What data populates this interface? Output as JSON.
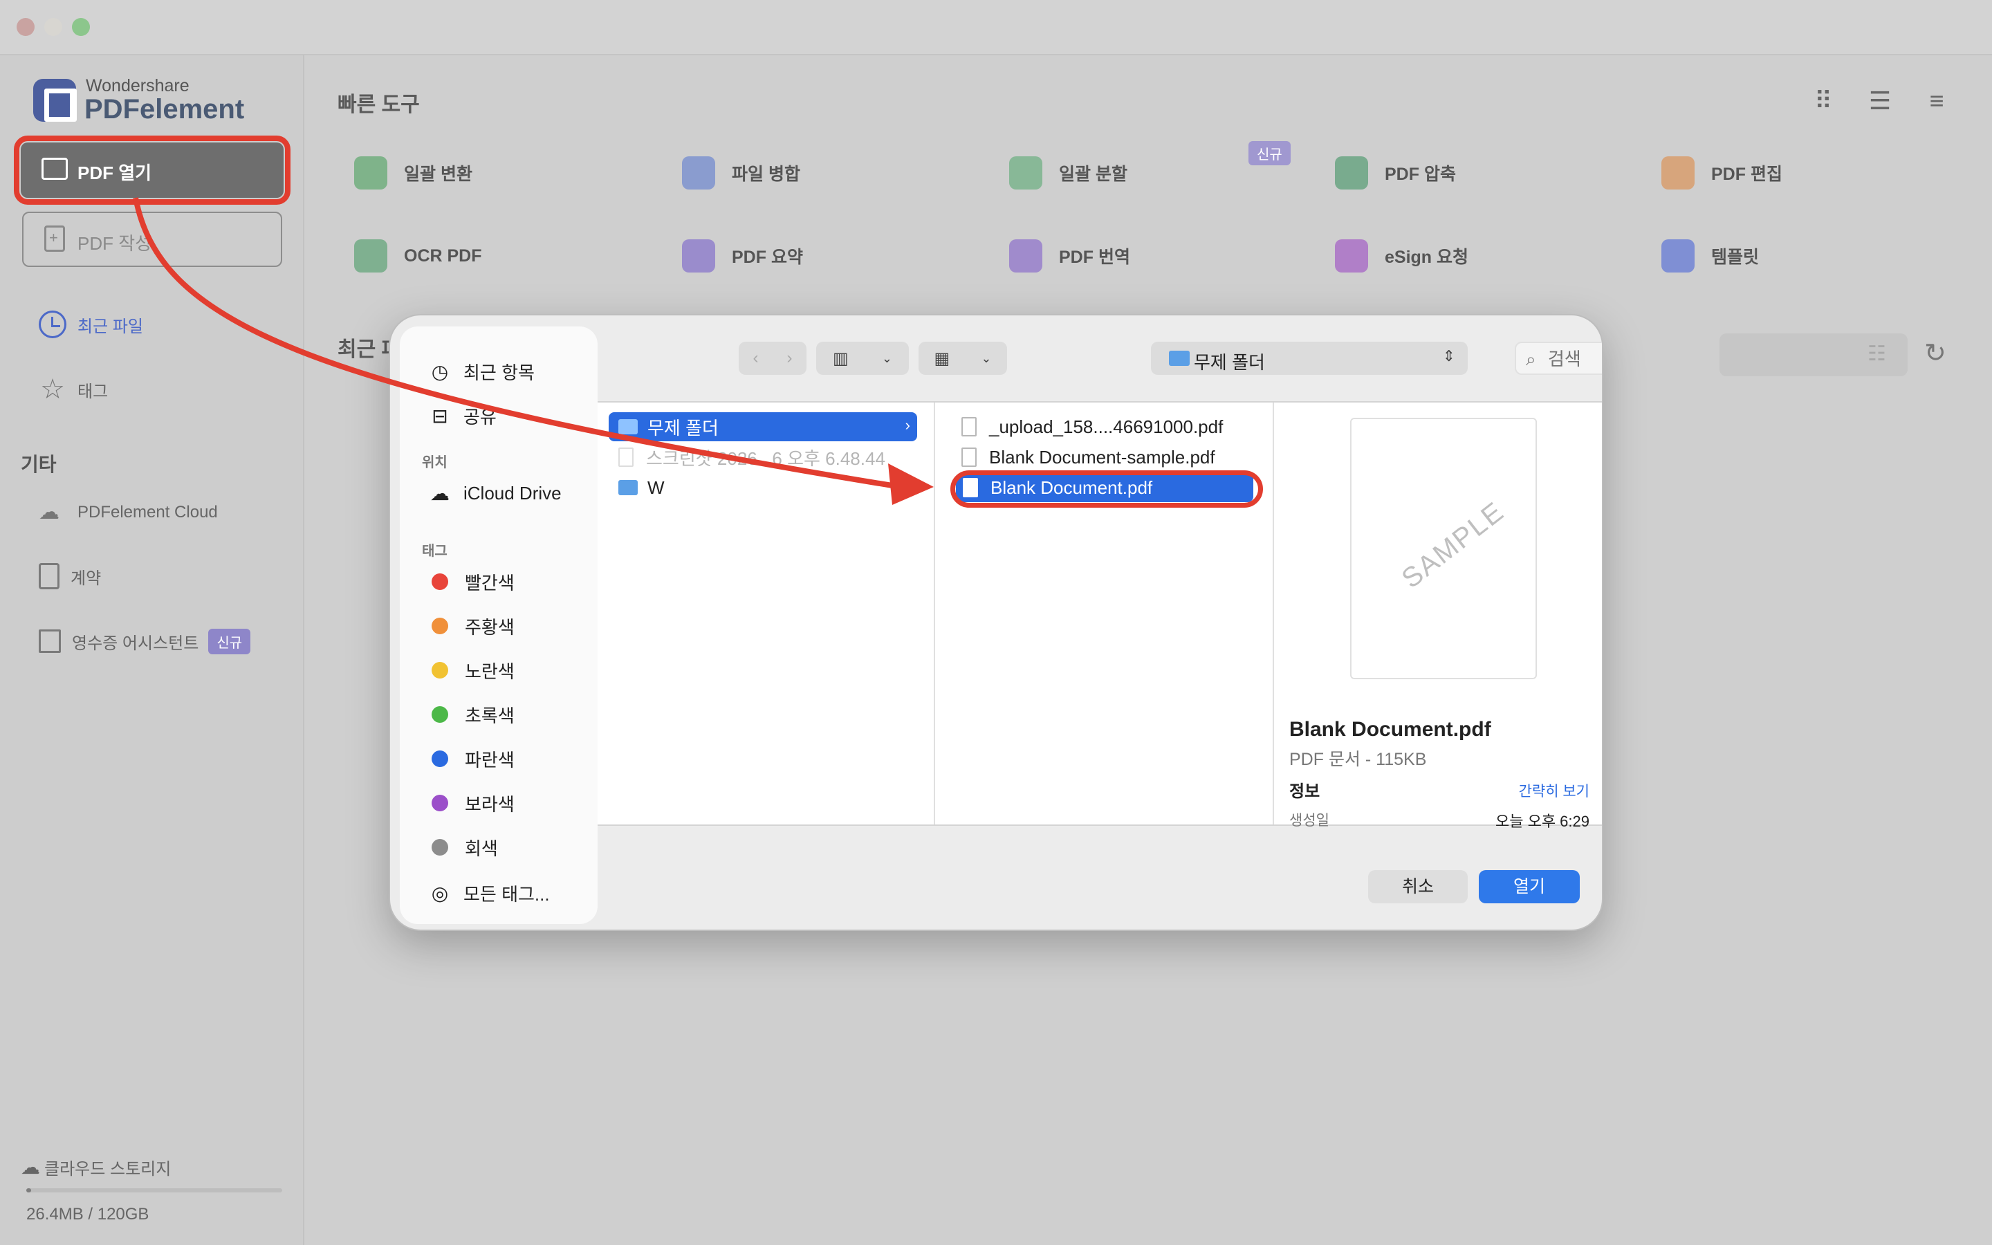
{
  "app": {
    "brand_small": "Wondershare",
    "brand_big": "PDFelement"
  },
  "sidebar": {
    "open_pdf": "PDF 열기",
    "create_pdf": "PDF 작성",
    "recent_files": "최근 파일",
    "tags": "태그",
    "other_section": "기타",
    "cloud": "PDFelement Cloud",
    "contract": "계약",
    "receipt": "영수증 어시스턴트",
    "receipt_badge": "신규",
    "storage_label": "클라우드 스토리지",
    "storage_usage": "26.4MB / 120GB",
    "storage_fraction": 0.0002
  },
  "main": {
    "quick_tools_title": "빠른 도구",
    "new_badge": "신규",
    "tools": [
      {
        "label": "일괄 변환",
        "icon": "batch-convert-icon",
        "color": "#7fb38a"
      },
      {
        "label": "파일 병합",
        "icon": "merge-icon",
        "color": "#8a9ccf"
      },
      {
        "label": "일괄 분할",
        "icon": "split-icon",
        "color": "#88b897"
      },
      {
        "label": "PDF 압축",
        "icon": "compress-icon",
        "color": "#79ab8e"
      },
      {
        "label": "PDF 편집",
        "icon": "edit-icon",
        "color": "#d7a57c"
      },
      {
        "label": "OCR PDF",
        "icon": "ocr-icon",
        "color": "#7fb090"
      },
      {
        "label": "PDF 요약",
        "icon": "summary-icon",
        "color": "#9a8ccc"
      },
      {
        "label": "PDF 번역",
        "icon": "translate-icon",
        "color": "#a08bcc"
      },
      {
        "label": "eSign 요청",
        "icon": "esign-icon",
        "color": "#b07fc8"
      },
      {
        "label": "템플릿",
        "icon": "template-icon",
        "color": "#7f8fd4"
      }
    ],
    "recent_title": "최근 파"
  },
  "dialog": {
    "sidebar": {
      "recents": "최근 항목",
      "shared": "공유",
      "locations_head": "위치",
      "icloud": "iCloud Drive",
      "tags_head": "태그",
      "tags": [
        {
          "label": "빨간색",
          "color": "#e8443a"
        },
        {
          "label": "주황색",
          "color": "#f0903a"
        },
        {
          "label": "노란색",
          "color": "#f1c232"
        },
        {
          "label": "초록색",
          "color": "#4cb848"
        },
        {
          "label": "파란색",
          "color": "#2a6ae0"
        },
        {
          "label": "보라색",
          "color": "#9b4fc9"
        },
        {
          "label": "회색",
          "color": "#8c8c8c"
        }
      ],
      "all_tags": "모든 태그..."
    },
    "path": "무제 폴더",
    "search_placeholder": "검색",
    "col1": {
      "selected_folder": "무제 폴더",
      "dim_item": "스크린샷 2026...6 오후 6.48.44",
      "folder_w": "W"
    },
    "col2": {
      "files": [
        "_upload_158....46691000.pdf",
        "Blank Document-sample.pdf",
        "Blank Document.pdf"
      ],
      "selected_index": 2
    },
    "preview": {
      "watermark": "SAMPLE",
      "name": "Blank Document.pdf",
      "kind": "PDF 문서 - 115KB",
      "info": "정보",
      "show_less": "간략히 보기",
      "created_label": "생성일",
      "created_value": "오늘 오후 6:29"
    },
    "cancel": "취소",
    "open": "열기"
  }
}
